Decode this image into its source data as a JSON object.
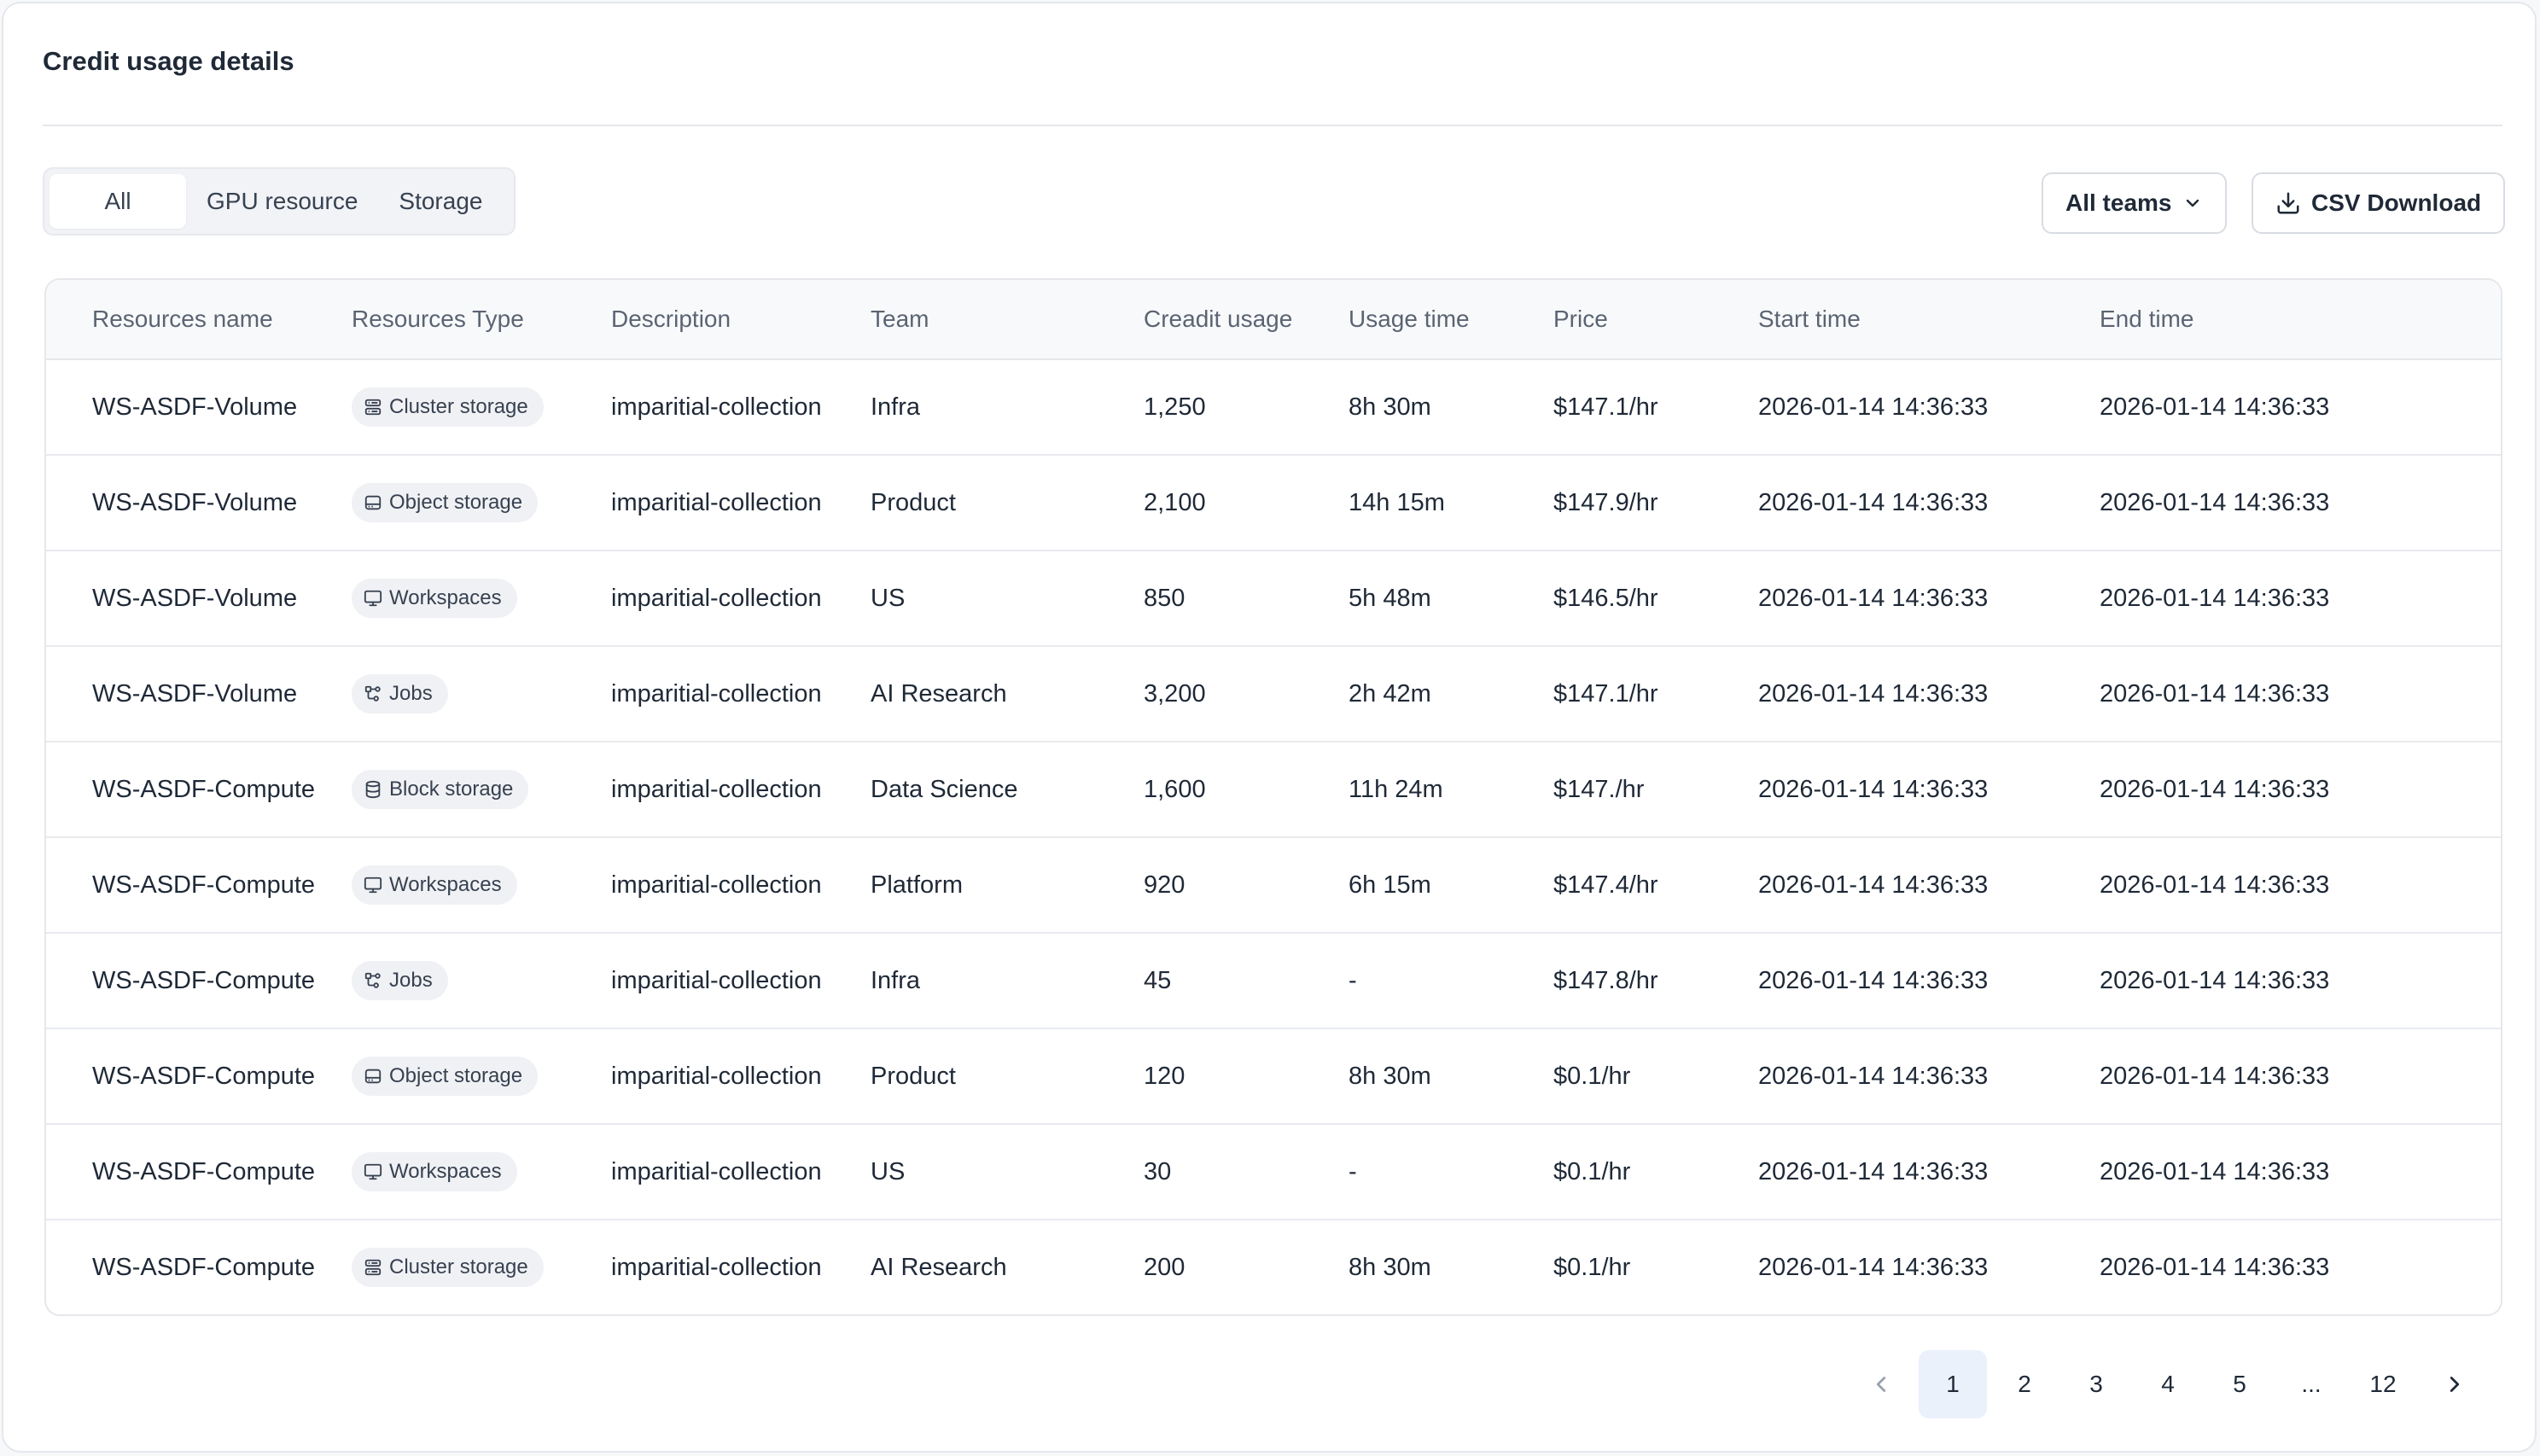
{
  "title": "Credit usage details",
  "filters": {
    "tabs": [
      {
        "label": "All",
        "active": true
      },
      {
        "label": "GPU resource",
        "active": false
      },
      {
        "label": "Storage",
        "active": false
      }
    ],
    "team_select": {
      "label": "All teams",
      "icon": "chevron-down-icon"
    },
    "csv_download": {
      "label": "CSV Download",
      "icon": "download-icon"
    }
  },
  "table": {
    "columns": [
      "Resources name",
      "Resources Type",
      "Description",
      "Team",
      "Creadit usage",
      "Usage time",
      "Price",
      "Start time",
      "End time"
    ],
    "rows": [
      {
        "name": "WS-ASDF-Volume",
        "type": "Cluster storage",
        "type_icon": "server-icon",
        "description": "imparitial-collection",
        "team": "Infra",
        "credit": "1,250",
        "usage_time": "8h 30m",
        "price": "$147.1/hr",
        "start": "2026-01-14 14:36:33",
        "end": "2026-01-14 14:36:33"
      },
      {
        "name": "WS-ASDF-Volume",
        "type": "Object storage",
        "type_icon": "hard-drive-icon",
        "description": "imparitial-collection",
        "team": "Product",
        "credit": "2,100",
        "usage_time": "14h 15m",
        "price": "$147.9/hr",
        "start": "2026-01-14 14:36:33",
        "end": "2026-01-14 14:36:33"
      },
      {
        "name": "WS-ASDF-Volume",
        "type": "Workspaces",
        "type_icon": "monitor-icon",
        "description": "imparitial-collection",
        "team": "US",
        "credit": "850",
        "usage_time": "5h 48m",
        "price": "$146.5/hr",
        "start": "2026-01-14 14:36:33",
        "end": "2026-01-14 14:36:33"
      },
      {
        "name": "WS-ASDF-Volume",
        "type": "Jobs",
        "type_icon": "workflow-icon",
        "description": "imparitial-collection",
        "team": "AI Research",
        "credit": "3,200",
        "usage_time": "2h 42m",
        "price": "$147.1/hr",
        "start": "2026-01-14 14:36:33",
        "end": "2026-01-14 14:36:33"
      },
      {
        "name": "WS-ASDF-Compute",
        "type": "Block storage",
        "type_icon": "database-icon",
        "description": "imparitial-collection",
        "team": "Data Science",
        "credit": "1,600",
        "usage_time": "11h 24m",
        "price": "$147./hr",
        "start": "2026-01-14 14:36:33",
        "end": "2026-01-14 14:36:33"
      },
      {
        "name": "WS-ASDF-Compute",
        "type": "Workspaces",
        "type_icon": "monitor-icon",
        "description": "imparitial-collection",
        "team": "Platform",
        "credit": "920",
        "usage_time": "6h 15m",
        "price": "$147.4/hr",
        "start": "2026-01-14 14:36:33",
        "end": "2026-01-14 14:36:33"
      },
      {
        "name": "WS-ASDF-Compute",
        "type": "Jobs",
        "type_icon": "workflow-icon",
        "description": "imparitial-collection",
        "team": "Infra",
        "credit": "45",
        "usage_time": "-",
        "price": "$147.8/hr",
        "start": "2026-01-14 14:36:33",
        "end": "2026-01-14 14:36:33"
      },
      {
        "name": "WS-ASDF-Compute",
        "type": "Object storage",
        "type_icon": "hard-drive-icon",
        "description": "imparitial-collection",
        "team": "Product",
        "credit": "120",
        "usage_time": "8h 30m",
        "price": "$0.1/hr",
        "start": "2026-01-14 14:36:33",
        "end": "2026-01-14 14:36:33"
      },
      {
        "name": "WS-ASDF-Compute",
        "type": "Workspaces",
        "type_icon": "monitor-icon",
        "description": "imparitial-collection",
        "team": "US",
        "credit": "30",
        "usage_time": "-",
        "price": "$0.1/hr",
        "start": "2026-01-14 14:36:33",
        "end": "2026-01-14 14:36:33"
      },
      {
        "name": "WS-ASDF-Compute",
        "type": "Cluster storage",
        "type_icon": "server-icon",
        "description": "imparitial-collection",
        "team": "AI Research",
        "credit": "200",
        "usage_time": "8h 30m",
        "price": "$0.1/hr",
        "start": "2026-01-14 14:36:33",
        "end": "2026-01-14 14:36:33"
      }
    ]
  },
  "pagination": {
    "prev_icon": "chevron-left-icon",
    "next_icon": "chevron-right-icon",
    "pages": [
      "1",
      "2",
      "3",
      "4",
      "5",
      "...",
      "12"
    ],
    "current": "1"
  },
  "colors": {
    "page_bg": "#f7f8fa",
    "border": "#e5e7eb",
    "header_bg": "#f8f9fb",
    "badge_bg": "#f0f1f4",
    "active_page_bg": "#eaf1fb",
    "text": "#1f2937",
    "muted_text": "#5b6472"
  }
}
